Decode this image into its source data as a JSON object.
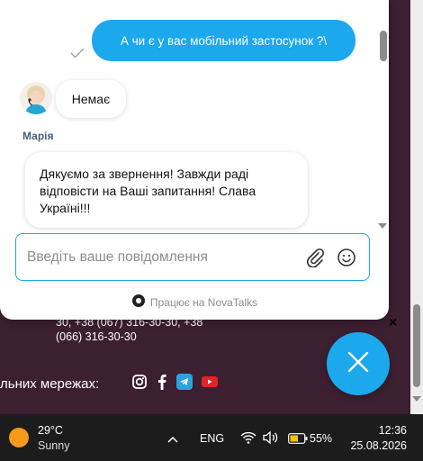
{
  "chat": {
    "outgoing_message": "А чи є у вас мобільний застосунок ?\\",
    "incoming_short": "Немає",
    "agent_name": "Марія",
    "incoming_long": "Дякуємо за звернення! Завжди раді відповісти на Ваші запитання! Слава Україні!!!",
    "input_placeholder": "Введіть ваше повідомлення",
    "input_value": "",
    "powered_by": "Працює на NovaTalks",
    "accent_color": "#1ba8ec"
  },
  "page": {
    "contact_line1": "30, +38 (067) 316-30-30, +38",
    "contact_line2": "(066) 316-30-30",
    "social_label": "льних мережах:",
    "social_icons": [
      "instagram-icon",
      "facebook-icon",
      "telegram-icon",
      "youtube-icon"
    ],
    "close_x": "×"
  },
  "taskbar": {
    "temperature": "29°C",
    "condition": "Sunny",
    "language": "ENG",
    "battery": "55%",
    "time": "12:36",
    "date": "25.08.2026"
  }
}
